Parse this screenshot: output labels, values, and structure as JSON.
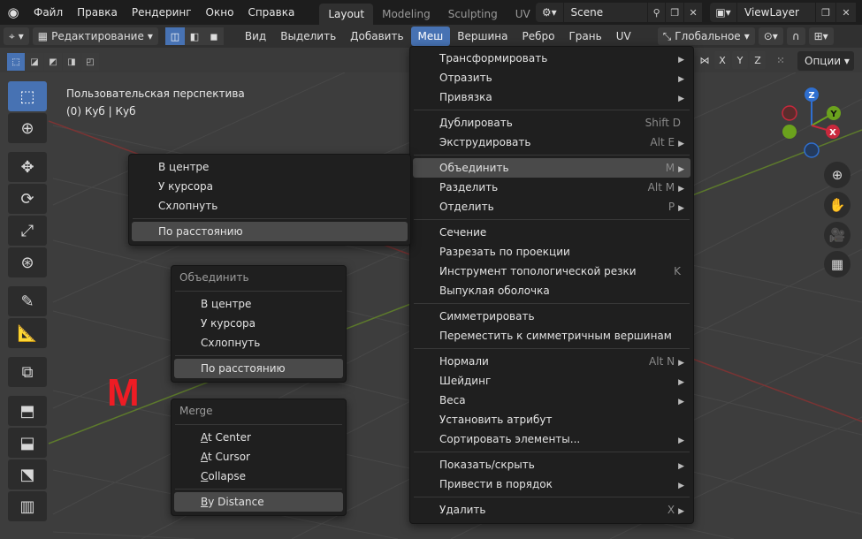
{
  "topbar": {
    "menus": [
      "Файл",
      "Правка",
      "Рендеринг",
      "Окно",
      "Справка"
    ],
    "tabs": [
      "Layout",
      "Modeling",
      "Sculpting",
      "UV"
    ],
    "active_tab": "Layout",
    "scene": "Scene",
    "view_layer": "ViewLayer"
  },
  "header": {
    "mode": "Редактирование",
    "menus": [
      "Вид",
      "Выделить",
      "Добавить",
      "Меш",
      "Вершина",
      "Ребро",
      "Грань",
      "UV"
    ],
    "active_menu": "Меш",
    "orientation": "Глобальное"
  },
  "row2": {
    "axes": [
      "X",
      "Y",
      "Z"
    ],
    "options": "Опции"
  },
  "viewport": {
    "info_line1": "Пользовательская перспектива",
    "info_line2": "(0) Куб | Куб",
    "overlay_letter": "M"
  },
  "gizmo": {
    "z": "Z",
    "y": "Y",
    "x": "X"
  },
  "mesh_menu": {
    "items": [
      {
        "label": "Трансформировать",
        "shortcut": "",
        "submenu": true
      },
      {
        "label": "Отразить",
        "shortcut": "",
        "submenu": true
      },
      {
        "label": "Привязка",
        "shortcut": "",
        "submenu": true
      },
      {
        "sep": true
      },
      {
        "label": "Дублировать",
        "shortcut": "Shift D",
        "submenu": false
      },
      {
        "label": "Экструдировать",
        "shortcut": "Alt E",
        "submenu": true
      },
      {
        "sep": true
      },
      {
        "label": "Объединить",
        "shortcut": "M",
        "submenu": true,
        "highlight": true
      },
      {
        "label": "Разделить",
        "shortcut": "Alt M",
        "submenu": true
      },
      {
        "label": "Отделить",
        "shortcut": "P",
        "submenu": true
      },
      {
        "sep": true
      },
      {
        "label": "Сечение",
        "shortcut": "",
        "submenu": false
      },
      {
        "label": "Разрезать по проекции",
        "shortcut": "",
        "submenu": false
      },
      {
        "label": "Инструмент топологической резки",
        "shortcut": "K",
        "submenu": false
      },
      {
        "label": "Выпуклая оболочка",
        "shortcut": "",
        "submenu": false
      },
      {
        "sep": true
      },
      {
        "label": "Симметрировать",
        "shortcut": "",
        "submenu": false
      },
      {
        "label": "Переместить к симметричным вершинам",
        "shortcut": "",
        "submenu": false
      },
      {
        "sep": true
      },
      {
        "label": "Нормали",
        "shortcut": "Alt N",
        "submenu": true
      },
      {
        "label": "Шейдинг",
        "shortcut": "",
        "submenu": true
      },
      {
        "label": "Веса",
        "shortcut": "",
        "submenu": true
      },
      {
        "label": "Установить атрибут",
        "shortcut": "",
        "submenu": false
      },
      {
        "label": "Сортировать элементы...",
        "shortcut": "",
        "submenu": true
      },
      {
        "sep": true
      },
      {
        "label": "Показать/скрыть",
        "shortcut": "",
        "submenu": true
      },
      {
        "label": "Привести в порядок",
        "shortcut": "",
        "submenu": true
      },
      {
        "sep": true
      },
      {
        "label": "Удалить",
        "shortcut": "X",
        "submenu": true
      }
    ]
  },
  "merge_submenu": {
    "items": [
      "В центре",
      "У курсора",
      "Схлопнуть",
      "По расстоянию"
    ],
    "highlight": 3
  },
  "merge_popup_ru": {
    "title": "Объединить",
    "items": [
      "В центре",
      "У курсора",
      "Схлопнуть",
      "По расстоянию"
    ],
    "highlight": 3
  },
  "merge_popup_en": {
    "title": "Merge",
    "items": [
      "At Center",
      "At Cursor",
      "Collapse",
      "By Distance"
    ],
    "highlight": 3
  }
}
